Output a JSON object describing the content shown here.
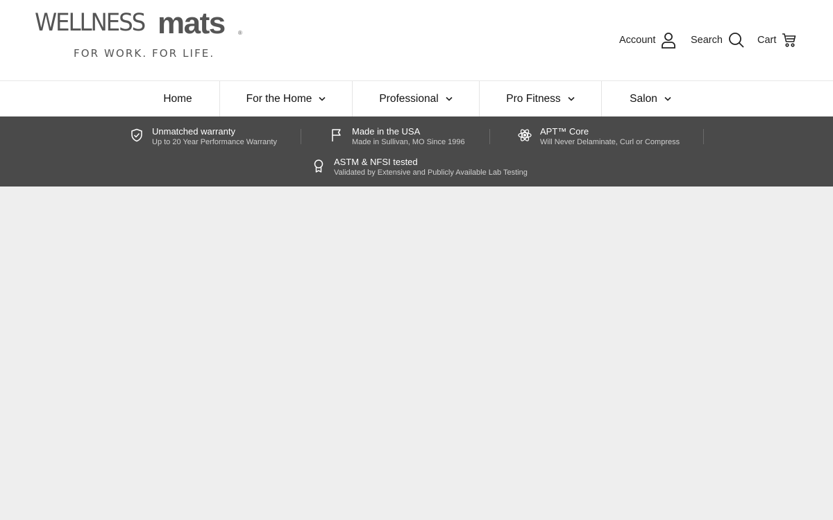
{
  "logo": {
    "word_light": "WELLNESS",
    "word_bold": "mats",
    "registered": "®",
    "tagline": "FOR WORK. FOR LIFE."
  },
  "utility_nav": {
    "account": {
      "label": "Account",
      "icon": "user-icon"
    },
    "search": {
      "label": "Search",
      "icon": "search-icon"
    },
    "cart": {
      "label": "Cart",
      "icon": "cart-icon"
    }
  },
  "main_nav": [
    {
      "label": "Home",
      "has_dropdown": false
    },
    {
      "label": "For the Home",
      "has_dropdown": true
    },
    {
      "label": "Professional",
      "has_dropdown": true
    },
    {
      "label": "Pro Fitness",
      "has_dropdown": true
    },
    {
      "label": "Salon",
      "has_dropdown": true
    }
  ],
  "features": [
    {
      "title": "Unmatched warranty",
      "subtitle": "Up to 20 Year Performance Warranty",
      "icon": "shield-check-icon"
    },
    {
      "title": "Made in the USA",
      "subtitle": "Made in Sullivan, MO Since 1996",
      "icon": "flag-icon"
    },
    {
      "title": "APT™ Core",
      "subtitle": "Will Never Delaminate, Curl or Compress",
      "icon": "atom-icon"
    },
    {
      "title": "ASTM & NFSI tested",
      "subtitle": "Validated by Extensive and Publicly Available Lab Testing",
      "icon": "award-ribbon-icon"
    }
  ],
  "colors": {
    "header_bg": "#ffffff",
    "feature_strip_bg": "#4a4a4a",
    "page_bg": "#eeeeee",
    "logo_text": "#555555"
  }
}
